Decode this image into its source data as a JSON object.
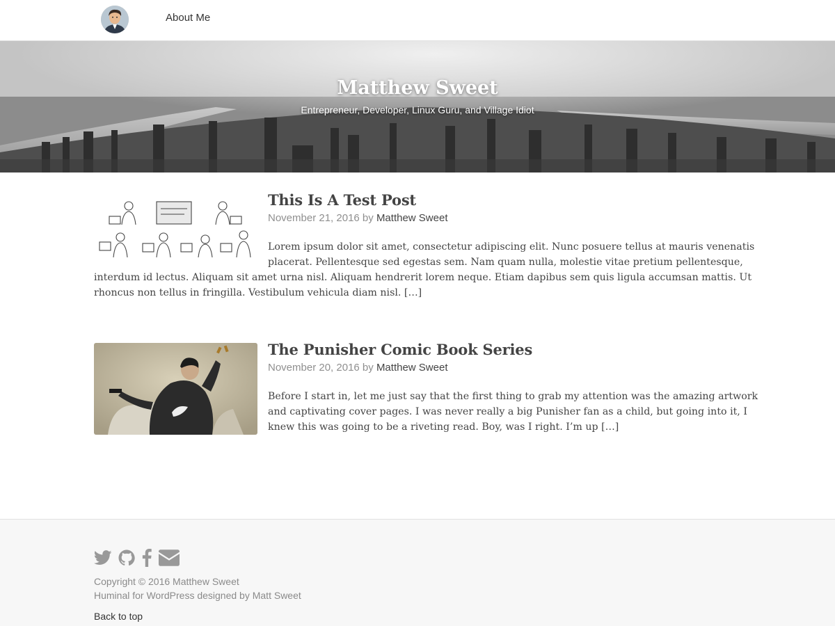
{
  "nav": {
    "avatar_icon": "avatar-portrait",
    "about_label": "About Me"
  },
  "hero": {
    "title": "Matthew Sweet",
    "tagline": "Entrepreneur, Developer, Linux Guru, and Village Idiot"
  },
  "posts": [
    {
      "title": "This Is A Test Post",
      "date": "November 21, 2016",
      "by": "by",
      "author": "Matthew Sweet",
      "thumbnail": "cartoon-people-at-laptops",
      "excerpt_lines": [
        "Lorem ipsum dolor sit amet, consectetur adipiscing elit. Nunc posuere tellus at mauris venenatis",
        "placerat. Pellentesque sed egestas sem. Nam quam nulla, molestie vitae pretium pellentesque,",
        "interdum id lectus. Aliquam sit amet urna nisl. Aliquam hendrerit lorem neque. Etiam dapibus sem quis ligula accumsan mattis. Ut",
        "rhoncus non tellus in fringilla. Vestibulum vehicula diam nisl."
      ],
      "more": "[…]"
    },
    {
      "title": "The Punisher Comic Book Series",
      "date": "November 20, 2016",
      "by": "by",
      "author": "Matthew Sweet",
      "thumbnail": "punisher-comic-art",
      "excerpt_lines": [
        "Before I start in, let me just say that the first thing to grab my attention was the amazing artwork",
        "and captivating cover pages. I was never really a big Punisher fan as a child, but going into it, I",
        "knew this was going to be a riveting read. Boy, was I right. I’m up"
      ],
      "more": "[…]"
    }
  ],
  "footer": {
    "social_icons": [
      "twitter-icon",
      "github-icon",
      "facebook-icon",
      "email-icon"
    ],
    "copyright": "Copyright © 2016 Matthew Sweet",
    "credit": "Huminal for WordPress designed by Matt Sweet",
    "back_to_top": "Back to top"
  },
  "colors": {
    "text": "#444444",
    "meta": "#8f8f8f",
    "footer_bg": "#f7f7f7",
    "icon": "#999999"
  }
}
